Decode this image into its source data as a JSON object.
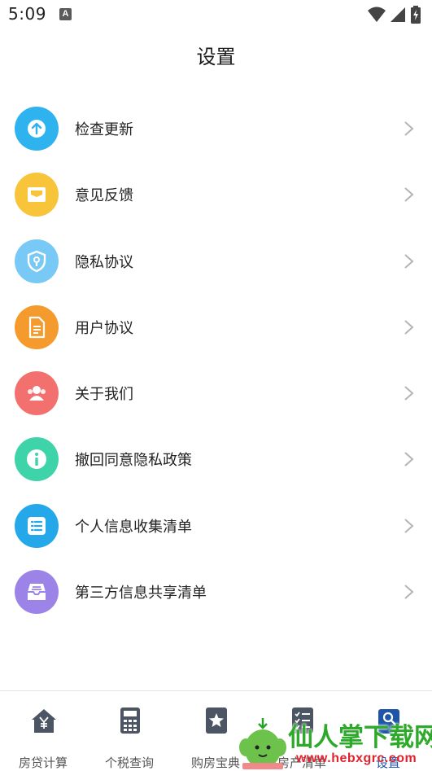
{
  "status_bar": {
    "time": "5:09",
    "notification_badge": "A"
  },
  "header": {
    "title": "设置"
  },
  "menu": {
    "items": [
      {
        "label": "检查更新",
        "icon": "upload-arrow-icon",
        "color": "#2fb3ef"
      },
      {
        "label": "意见反馈",
        "icon": "mail-icon",
        "color": "#f7c43a"
      },
      {
        "label": "隐私协议",
        "icon": "shield-icon",
        "color": "#79c9f6"
      },
      {
        "label": "用户协议",
        "icon": "document-icon",
        "color": "#f59b2d"
      },
      {
        "label": "关于我们",
        "icon": "people-icon",
        "color": "#f2716f"
      },
      {
        "label": "撤回同意隐私政策",
        "icon": "info-icon",
        "color": "#3fd3aa"
      },
      {
        "label": "个人信息收集清单",
        "icon": "list-icon",
        "color": "#24a8ea"
      },
      {
        "label": "第三方信息共享清单",
        "icon": "inbox-icon",
        "color": "#9c83e8"
      }
    ]
  },
  "tab_bar": {
    "tabs": [
      {
        "label": "房贷计算",
        "icon": "house-yen-icon"
      },
      {
        "label": "个税查询",
        "icon": "calculator-icon"
      },
      {
        "label": "购房宝典",
        "icon": "star-book-icon"
      },
      {
        "label": "房产清单",
        "icon": "checklist-icon"
      },
      {
        "label": "设置",
        "icon": "search-icon",
        "active": true
      }
    ]
  },
  "watermark": {
    "text": "仙人掌下载网",
    "url": "www.hebxgrc.com"
  }
}
